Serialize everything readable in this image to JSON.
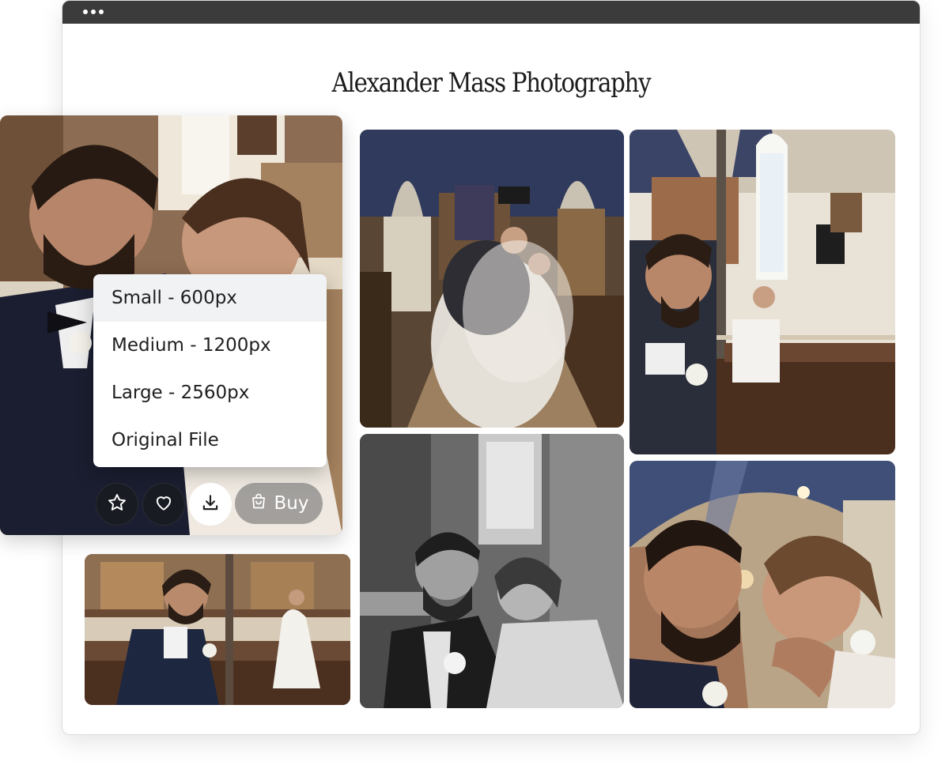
{
  "window": {
    "titlebar_dots": 3
  },
  "gallery": {
    "title": "Alexander Mass Photography",
    "photos": [
      {
        "name": "couple-portrait-with-menu"
      },
      {
        "name": "veil-embrace-church-aisle"
      },
      {
        "name": "groom-and-bride-in-pews"
      },
      {
        "name": "groom-pose-bride-background"
      },
      {
        "name": "black-and-white-couple"
      },
      {
        "name": "couple-forehead-kiss"
      }
    ]
  },
  "download_menu": {
    "items": [
      {
        "label": "Small - 600px",
        "active": true
      },
      {
        "label": "Medium - 1200px",
        "active": false
      },
      {
        "label": "Large - 2560px",
        "active": false
      },
      {
        "label": "Original File",
        "active": false
      }
    ]
  },
  "actions": {
    "favorite_icon": "star-icon",
    "like_icon": "heart-icon",
    "download_icon": "download-icon",
    "buy_label": "Buy",
    "buy_icon": "shopping-bag-icon"
  },
  "colors": {
    "titlebar": "#3b3b3b",
    "menu_active_bg": "#f1f2f4",
    "text": "#1c1c1c"
  }
}
